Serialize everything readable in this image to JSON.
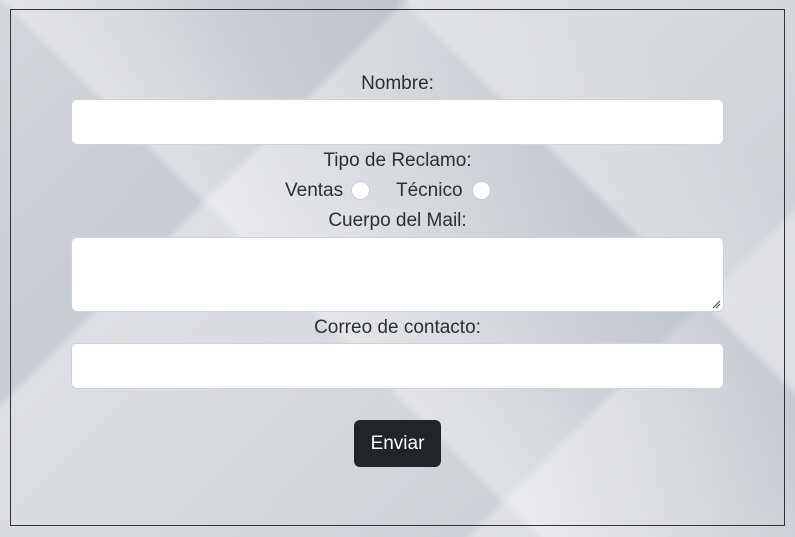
{
  "form": {
    "nombre_label": "Nombre:",
    "nombre_value": "",
    "tipo_label": "Tipo de Reclamo:",
    "radio_options": [
      {
        "label": "Ventas",
        "checked": false
      },
      {
        "label": "Técnico",
        "checked": false
      }
    ],
    "cuerpo_label": "Cuerpo del Mail:",
    "cuerpo_value": "",
    "correo_label": "Correo de contacto:",
    "correo_value": "",
    "submit_label": "Enviar"
  },
  "colors": {
    "button_bg": "#212529",
    "button_text": "#ffffff",
    "input_bg": "#ffffff",
    "text": "#2b2f33"
  }
}
